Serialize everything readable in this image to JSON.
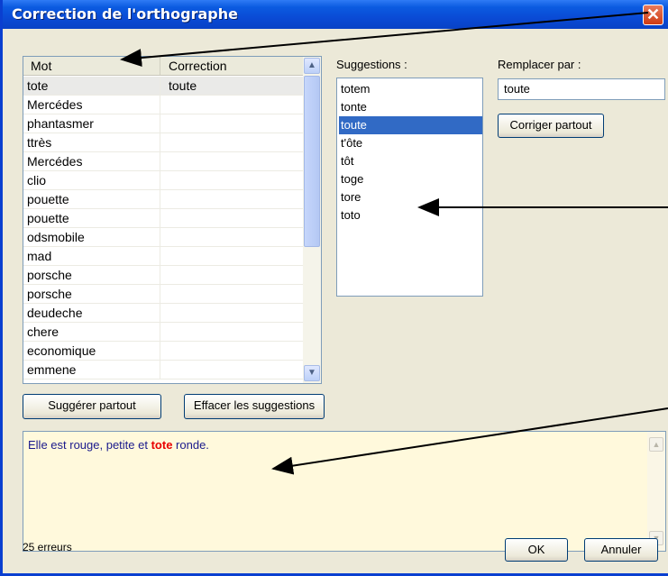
{
  "window": {
    "title": "Correction de l'orthographe",
    "close_label": "✕"
  },
  "wordlist": {
    "columns": [
      "Mot",
      "Correction"
    ],
    "rows": [
      {
        "mot": "tote",
        "correction": "toute"
      },
      {
        "mot": "Mercédes",
        "correction": ""
      },
      {
        "mot": "phantasmer",
        "correction": ""
      },
      {
        "mot": "ttrès",
        "correction": ""
      },
      {
        "mot": "Mercédes",
        "correction": ""
      },
      {
        "mot": "clio",
        "correction": ""
      },
      {
        "mot": "pouette",
        "correction": ""
      },
      {
        "mot": "pouette",
        "correction": ""
      },
      {
        "mot": "odsmobile",
        "correction": ""
      },
      {
        "mot": "mad",
        "correction": ""
      },
      {
        "mot": "porsche",
        "correction": ""
      },
      {
        "mot": "porsche",
        "correction": ""
      },
      {
        "mot": "deudeche",
        "correction": ""
      },
      {
        "mot": "chere",
        "correction": ""
      },
      {
        "mot": "economique",
        "correction": ""
      },
      {
        "mot": "emmene",
        "correction": ""
      }
    ]
  },
  "suggestions": {
    "label": "Suggestions :",
    "items": [
      "totem",
      "tonte",
      "toute",
      "t'ôte",
      "tôt",
      "toge",
      "tore",
      "toto"
    ],
    "selected": "toute"
  },
  "replace": {
    "label": "Remplacer par :",
    "value": "toute",
    "button": "Corriger partout"
  },
  "buttons": {
    "suggest_all": "Suggérer partout",
    "clear_suggestions": "Effacer les suggestions",
    "ok": "OK",
    "cancel": "Annuler"
  },
  "context": {
    "before": "Elle est rouge, petite et ",
    "error_word": "tote",
    "after": " ronde."
  },
  "status": {
    "errors": "25 erreurs"
  },
  "colors": {
    "titlebar": "#0a4bd6",
    "selection": "#316ac5",
    "error_word": "#e80000",
    "context_bg": "#fff9dc",
    "context_text": "#1a1a8c"
  }
}
